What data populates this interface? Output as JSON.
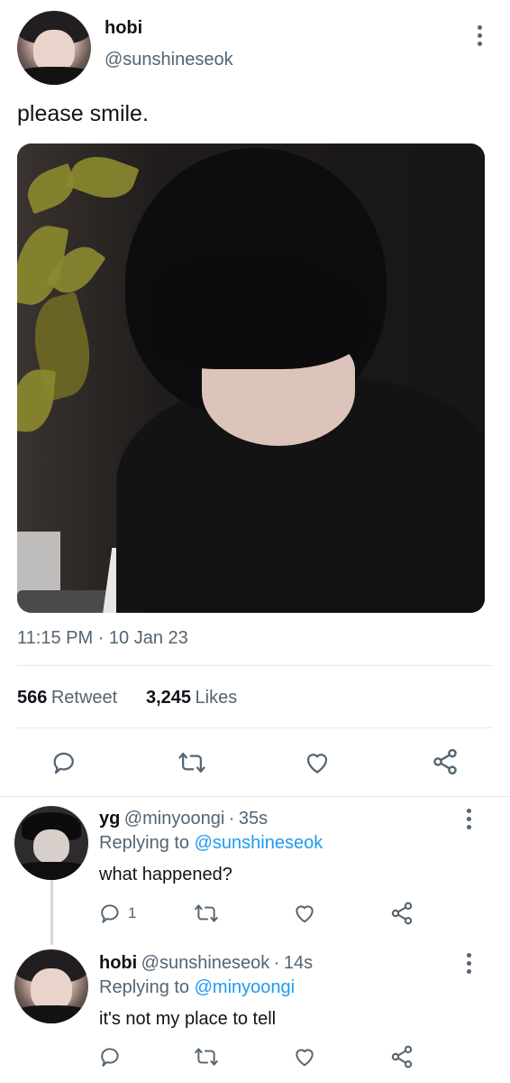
{
  "tweet": {
    "author_name": "hobi",
    "author_handle": "@sunshineseok",
    "text": "please smile.",
    "time": "11:15 PM",
    "date": "10 Jan 23",
    "separator": "·"
  },
  "stats": {
    "retweets_count": "566",
    "retweets_label": "Retweet",
    "likes_count": "3,245",
    "likes_label": "Likes"
  },
  "replies": [
    {
      "name": "yg",
      "handle": "@minyoongi",
      "age": "35s",
      "replying_prefix": "Replying to",
      "replying_to": "@sunshineseok",
      "text": "what happened?",
      "reply_count": "1"
    },
    {
      "name": "hobi",
      "handle": "@sunshineseok",
      "age": "14s",
      "replying_prefix": "Replying to",
      "replying_to": "@minyoongi",
      "text": "it's not my place to tell",
      "reply_count": ""
    }
  ],
  "colors": {
    "accent": "#1d9bf0",
    "secondary_text": "#536471",
    "primary_text": "#0f1419"
  },
  "icons": [
    "more-icon",
    "reply-icon",
    "retweet-icon",
    "like-icon",
    "share-icon"
  ]
}
